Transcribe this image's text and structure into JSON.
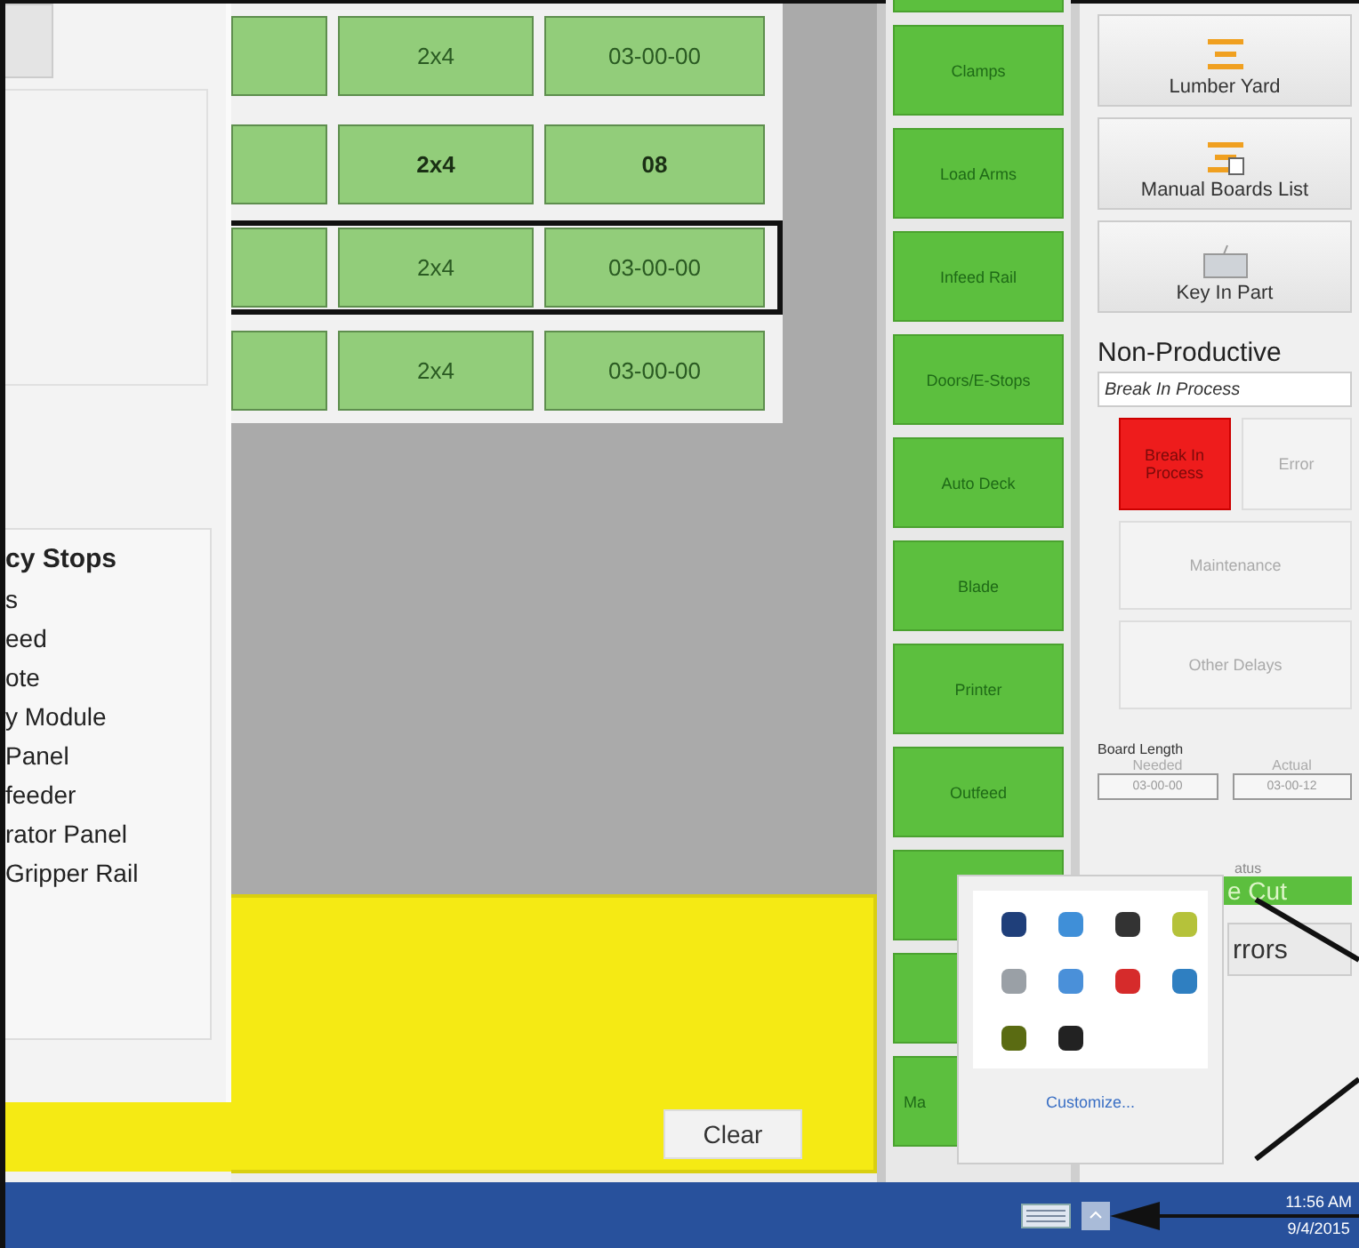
{
  "emergency_stops": {
    "title": "cy Stops",
    "items": [
      "s",
      "eed",
      "ote",
      "y Module",
      "Panel",
      "feeder",
      "rator Panel",
      "Gripper Rail"
    ]
  },
  "parts_grid": {
    "rows": [
      {
        "cells": [
          "",
          "2x4",
          "03-00-00"
        ],
        "bold": false,
        "selected": false
      },
      {
        "cells": [
          "",
          "2x4",
          "08"
        ],
        "bold": true,
        "selected": false
      },
      {
        "cells": [
          "",
          "2x4",
          "03-00-00"
        ],
        "bold": false,
        "selected": true
      },
      {
        "cells": [
          "",
          "2x4",
          "03-00-00"
        ],
        "bold": false,
        "selected": false
      }
    ]
  },
  "message_panel": {
    "clear_button": "Clear"
  },
  "station_buttons": [
    {
      "kind": "cut"
    },
    {
      "kind": "full",
      "label": "Clamps"
    },
    {
      "kind": "full",
      "label": "Load Arms"
    },
    {
      "kind": "full",
      "label": "Infeed Rail"
    },
    {
      "kind": "full",
      "label": "Doors/E-Stops"
    },
    {
      "kind": "full",
      "label": "Auto Deck"
    },
    {
      "kind": "full",
      "label": "Blade"
    },
    {
      "kind": "full",
      "label": "Printer"
    },
    {
      "kind": "full",
      "label": "Outfeed"
    },
    {
      "kind": "covered"
    },
    {
      "kind": "covered"
    },
    {
      "kind": "partial",
      "label": "Ma"
    }
  ],
  "side_panel": {
    "actions": [
      {
        "label": "Lumber Yard"
      },
      {
        "label": "Manual Boards List"
      },
      {
        "label": "Key In Part"
      }
    ],
    "non_productive": {
      "title": "Non-Productive",
      "current": "Break In Process",
      "buttons": [
        {
          "label": "Break In Process",
          "active": true,
          "disabled": false,
          "wide": false
        },
        {
          "label": "Error",
          "active": false,
          "disabled": true,
          "wide": false
        },
        {
          "label": "Maintenance",
          "active": false,
          "disabled": true,
          "wide": true
        },
        {
          "label": "Other Delays",
          "active": false,
          "disabled": true,
          "wide": true
        }
      ]
    },
    "board_length": {
      "title": "Board Length",
      "needed_label": "Needed",
      "needed": "03-00-00",
      "actual_label": "Actual",
      "actual": "03-00-12"
    },
    "status_label": "atus",
    "status_value": "e Cut",
    "errors_button": "rrors"
  },
  "tray_popup": {
    "icons": [
      {
        "color": "#1f3f7a"
      },
      {
        "color": "#3f8fd8"
      },
      {
        "color": "#333333"
      },
      {
        "color": "#b5c23a"
      },
      {
        "color": "#9aa0a6"
      },
      {
        "color": "#4a90d9"
      },
      {
        "color": "#d62b2b"
      },
      {
        "color": "#2f7fc1"
      },
      {
        "color": "#5a6b12"
      },
      {
        "color": "#222222"
      }
    ],
    "customize_link": "Customize..."
  },
  "taskbar": {
    "time": "11:56 AM",
    "date": "9/4/2015"
  }
}
